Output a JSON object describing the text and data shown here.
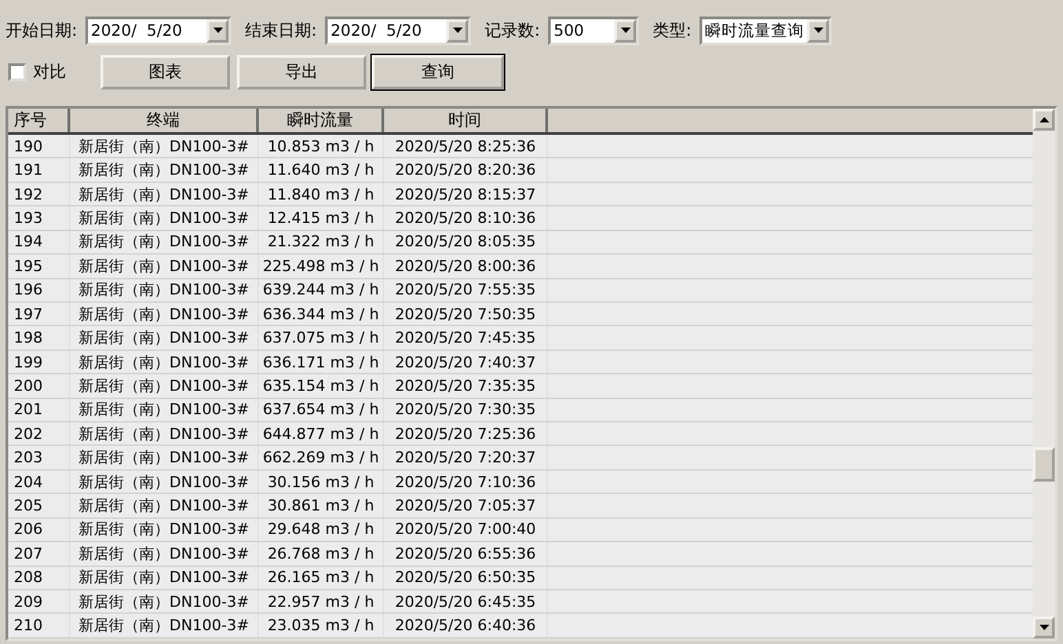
{
  "filters": [
    {
      "label": "开始日期:",
      "value": "2020/  5/20",
      "kind": "date"
    },
    {
      "label": "结束日期:",
      "value": "2020/  5/20",
      "kind": "date"
    },
    {
      "label": "记录数:",
      "value": "500",
      "kind": "count"
    },
    {
      "label": "类型:",
      "value": "瞬时流量查询",
      "kind": "type"
    }
  ],
  "compare": {
    "label": "对比",
    "checked": false
  },
  "buttons": [
    {
      "label": "图表",
      "default": false
    },
    {
      "label": "导出",
      "default": false
    },
    {
      "label": "查询",
      "default": true
    }
  ],
  "table": {
    "columns": [
      "序号",
      "终端",
      "瞬时流量",
      "时间"
    ],
    "rows": [
      [
        "190",
        "新居街（南）DN100-3#",
        "10.853 m3 / h",
        "2020/5/20 8:25:36"
      ],
      [
        "191",
        "新居街（南）DN100-3#",
        "11.640 m3 / h",
        "2020/5/20 8:20:36"
      ],
      [
        "192",
        "新居街（南）DN100-3#",
        "11.840 m3 / h",
        "2020/5/20 8:15:37"
      ],
      [
        "193",
        "新居街（南）DN100-3#",
        "12.415 m3 / h",
        "2020/5/20 8:10:36"
      ],
      [
        "194",
        "新居街（南）DN100-3#",
        "21.322 m3 / h",
        "2020/5/20 8:05:35"
      ],
      [
        "195",
        "新居街（南）DN100-3#",
        "225.498 m3 / h",
        "2020/5/20 8:00:36"
      ],
      [
        "196",
        "新居街（南）DN100-3#",
        "639.244 m3 / h",
        "2020/5/20 7:55:35"
      ],
      [
        "197",
        "新居街（南）DN100-3#",
        "636.344 m3 / h",
        "2020/5/20 7:50:35"
      ],
      [
        "198",
        "新居街（南）DN100-3#",
        "637.075 m3 / h",
        "2020/5/20 7:45:35"
      ],
      [
        "199",
        "新居街（南）DN100-3#",
        "636.171 m3 / h",
        "2020/5/20 7:40:37"
      ],
      [
        "200",
        "新居街（南）DN100-3#",
        "635.154 m3 / h",
        "2020/5/20 7:35:35"
      ],
      [
        "201",
        "新居街（南）DN100-3#",
        "637.654 m3 / h",
        "2020/5/20 7:30:35"
      ],
      [
        "202",
        "新居街（南）DN100-3#",
        "644.877 m3 / h",
        "2020/5/20 7:25:36"
      ],
      [
        "203",
        "新居街（南）DN100-3#",
        "662.269 m3 / h",
        "2020/5/20 7:20:37"
      ],
      [
        "204",
        "新居街（南）DN100-3#",
        "30.156 m3 / h",
        "2020/5/20 7:10:36"
      ],
      [
        "205",
        "新居街（南）DN100-3#",
        "30.861 m3 / h",
        "2020/5/20 7:05:37"
      ],
      [
        "206",
        "新居街（南）DN100-3#",
        "29.648 m3 / h",
        "2020/5/20 7:00:40"
      ],
      [
        "207",
        "新居街（南）DN100-3#",
        "26.768 m3 / h",
        "2020/5/20 6:55:36"
      ],
      [
        "208",
        "新居街（南）DN100-3#",
        "26.165 m3 / h",
        "2020/5/20 6:50:35"
      ],
      [
        "209",
        "新居街（南）DN100-3#",
        "22.957 m3 / h",
        "2020/5/20 6:45:35"
      ],
      [
        "210",
        "新居街（南）DN100-3#",
        "23.035 m3 / h",
        "2020/5/20 6:40:36"
      ]
    ]
  }
}
